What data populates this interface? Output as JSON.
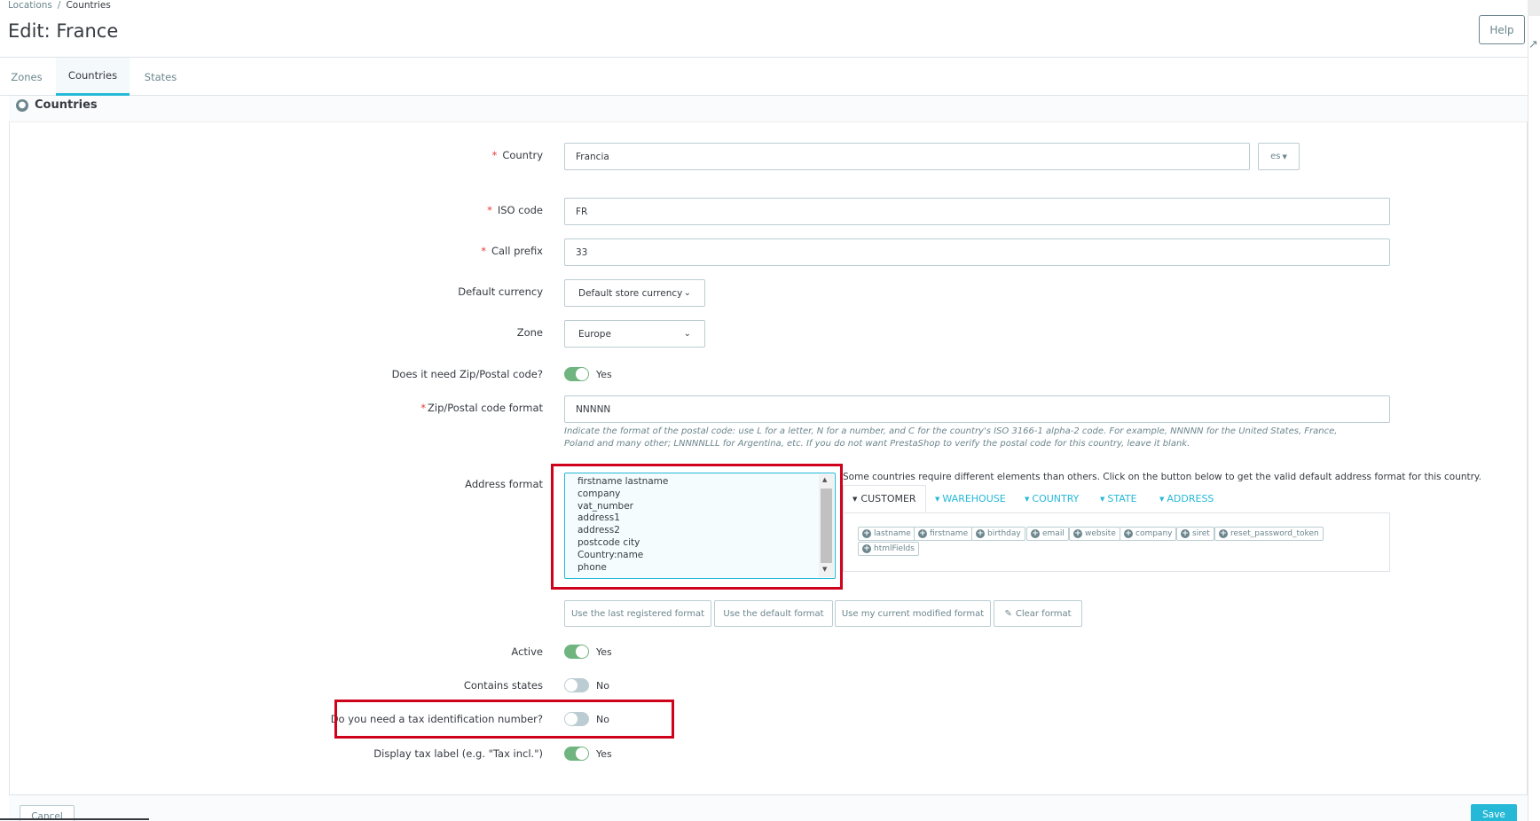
{
  "breadcrumb": {
    "parent": "Locations",
    "current": "Countries"
  },
  "page_title": "Edit: France",
  "help_label": "Help",
  "tabs": [
    {
      "label": "Zones"
    },
    {
      "label": "Countries",
      "active": true
    },
    {
      "label": "States"
    }
  ],
  "panel_title": "Countries",
  "form": {
    "country": {
      "label": "Country",
      "value": "Francia",
      "lang": "es"
    },
    "iso": {
      "label": "ISO code",
      "value": "FR"
    },
    "call_prefix": {
      "label": "Call prefix",
      "value": "33"
    },
    "currency": {
      "label": "Default currency",
      "value": "Default store currency"
    },
    "zone": {
      "label": "Zone",
      "value": "Europe"
    },
    "need_zip": {
      "label": "Does it need Zip/Postal code?",
      "state": "Yes",
      "on": true
    },
    "zip_format": {
      "label": "Zip/Postal code format",
      "value": "NNNNN",
      "hint": "Indicate the format of the postal code: use L for a letter, N for a number, and C for the country's ISO 3166-1 alpha-2 code. For example, NNNNN for the United States, France, Poland and many other; LNNNNLLL for Argentina, etc. If you do not want PrestaShop to verify the postal code for this country, leave it blank."
    },
    "address_format": {
      "label": "Address format",
      "lines": [
        "firstname lastname",
        "company",
        "vat_number",
        "address1",
        "address2",
        "postcode city",
        "Country:name",
        "phone"
      ],
      "info": "Some countries require different elements than others. Click on the button below to get the valid default address format for this country.",
      "tabs": [
        "CUSTOMER",
        "WAREHOUSE",
        "COUNTRY",
        "STATE",
        "ADDRESS"
      ],
      "fields": [
        "lastname",
        "firstname",
        "birthday",
        "email",
        "website",
        "company",
        "siret",
        "reset_password_token",
        "htmlFields"
      ],
      "buttons": [
        "Use the last registered format",
        "Use the default format",
        "Use my current modified format",
        "Clear format"
      ]
    },
    "active": {
      "label": "Active",
      "state": "Yes",
      "on": true
    },
    "contains_states": {
      "label": "Contains states",
      "state": "No",
      "on": false
    },
    "need_tax_id": {
      "label": "Do you need a tax identification number?",
      "state": "No",
      "on": false
    },
    "display_tax": {
      "label": "Display tax label (e.g. \"Tax incl.\")",
      "state": "Yes",
      "on": true
    }
  },
  "footer": {
    "cancel": "Cancel",
    "save": "Save"
  },
  "colors": {
    "accent": "#25b9d7",
    "highlight": "#d0021b",
    "switch_on": "#70b580"
  }
}
